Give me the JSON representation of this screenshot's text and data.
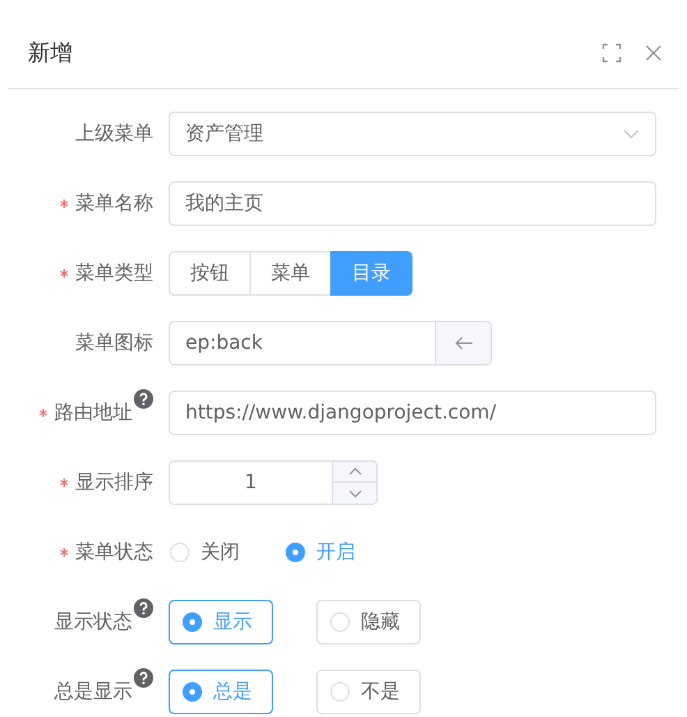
{
  "dialog": {
    "title": "新增"
  },
  "fields": [
    {
      "kind": "select",
      "label": "上级菜单",
      "required": false,
      "help": false,
      "value": "资产管理"
    },
    {
      "kind": "input",
      "label": "菜单名称",
      "required": true,
      "help": false,
      "value": "我的主页"
    },
    {
      "kind": "segmented",
      "label": "菜单类型",
      "required": true,
      "help": false,
      "options": [
        {
          "label": "按钮",
          "selected": false
        },
        {
          "label": "菜单",
          "selected": false
        },
        {
          "label": "目录",
          "selected": true
        }
      ]
    },
    {
      "kind": "icon-input",
      "label": "菜单图标",
      "required": false,
      "help": false,
      "value": "ep:back"
    },
    {
      "kind": "input",
      "label": "路由地址",
      "required": true,
      "help": true,
      "value": "https://www.djangoproject.com/"
    },
    {
      "kind": "number",
      "label": "显示排序",
      "required": true,
      "help": false,
      "value": "1"
    },
    {
      "kind": "radio",
      "label": "菜单状态",
      "required": true,
      "help": false,
      "options": [
        {
          "label": "关闭",
          "selected": false
        },
        {
          "label": "开启",
          "selected": true
        }
      ]
    },
    {
      "kind": "radio-bordered",
      "label": "显示状态",
      "required": false,
      "help": true,
      "options": [
        {
          "label": "显示",
          "selected": true
        },
        {
          "label": "隐藏",
          "selected": false
        }
      ]
    },
    {
      "kind": "radio-bordered",
      "label": "总是显示",
      "required": false,
      "help": true,
      "options": [
        {
          "label": "总是",
          "selected": true
        },
        {
          "label": "不是",
          "selected": false
        }
      ]
    }
  ]
}
